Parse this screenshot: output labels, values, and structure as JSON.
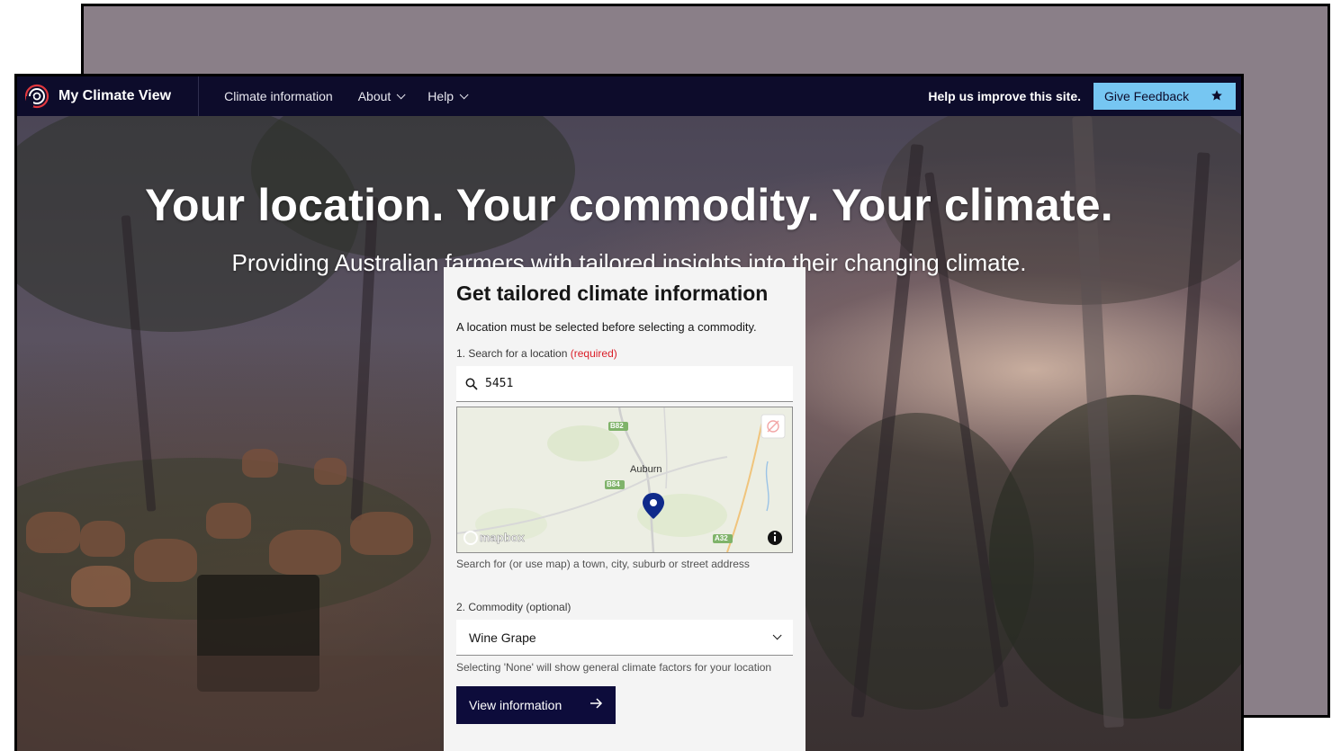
{
  "nav": {
    "brand": "My Climate View",
    "links": [
      {
        "label": "Climate information",
        "has_dropdown": false
      },
      {
        "label": "About",
        "has_dropdown": true
      },
      {
        "label": "Help",
        "has_dropdown": true
      }
    ],
    "help_text": "Help us improve this site.",
    "feedback_label": "Give Feedback"
  },
  "hero": {
    "title": "Your location. Your commodity. Your climate.",
    "subtitle": "Providing Australian farmers with tailored insights into their changing climate."
  },
  "card": {
    "title": "Get tailored climate information",
    "note": "A location must be selected before selecting a commodity.",
    "location_label": "1. Search for a location",
    "required_text": "(required)",
    "search_value": "5451",
    "map": {
      "town_label": "Auburn",
      "roads": [
        "B82",
        "B84",
        "A32"
      ],
      "attribution": "mapbox"
    },
    "map_help": "Search for (or use map) a town, city, suburb or street address",
    "commodity_label": "2. Commodity (optional)",
    "commodity_value": "Wine Grape",
    "commodity_help": "Selecting 'None' will show general climate factors for your location",
    "submit_label": "View information"
  },
  "colors": {
    "nav_bg": "#0d0c2b",
    "feedback_bg": "#76c6f2",
    "button_bg": "#0d0c3b",
    "required": "#da1e28",
    "pin": "#0f2a8a"
  }
}
